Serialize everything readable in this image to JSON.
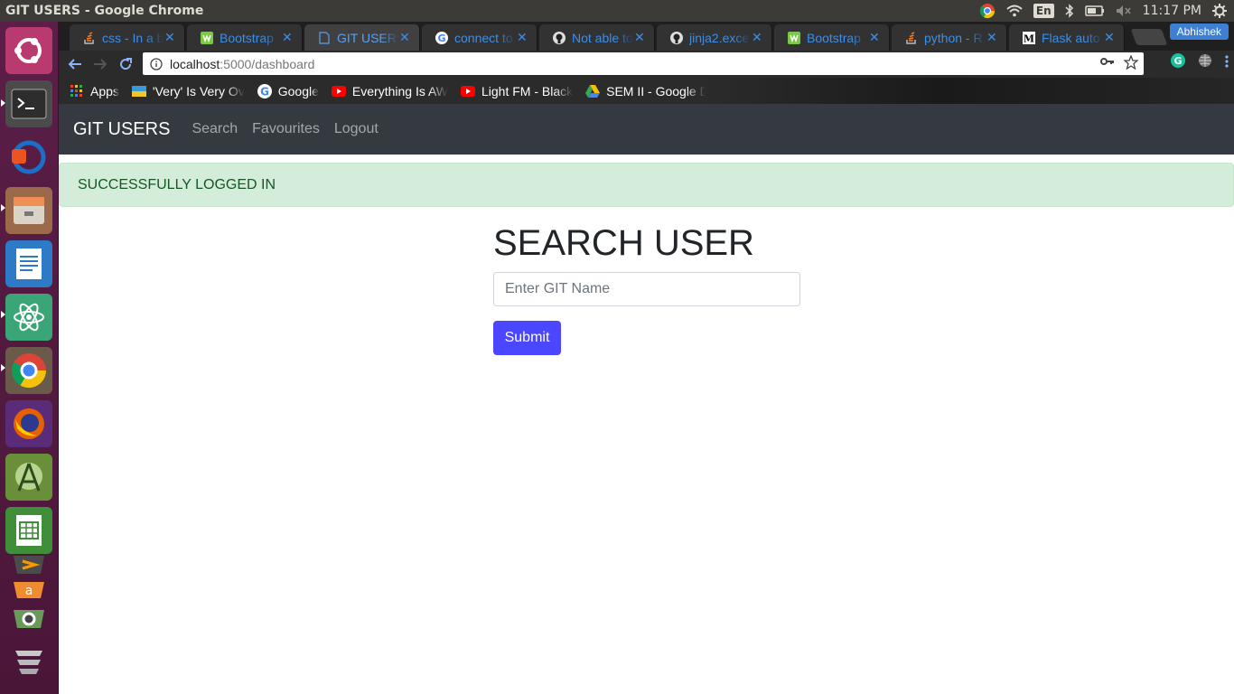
{
  "os_panel": {
    "window_title": "GIT USERS - Google Chrome",
    "language": "En",
    "clock": "11:17 PM"
  },
  "launcher": {
    "items": [
      "ubuntu-dash",
      "terminal",
      "software-updater",
      "files",
      "libreoffice-writer",
      "atom",
      "chrome",
      "firefox",
      "android-studio",
      "libreoffice-calc",
      "sublime-text",
      "amazon",
      "system-settings",
      "trash"
    ]
  },
  "browser": {
    "tabs": [
      {
        "label": "css - In a bu",
        "icon": "stackoverflow-icon"
      },
      {
        "label": "Bootstrap",
        "icon": "bootstrap-icon"
      },
      {
        "label": "GIT USERS",
        "icon": "page-icon",
        "active": true
      },
      {
        "label": "connect to",
        "icon": "google-icon"
      },
      {
        "label": "Not able to",
        "icon": "github-icon"
      },
      {
        "label": "jinja2.exce",
        "icon": "github-icon"
      },
      {
        "label": "Bootstrap",
        "icon": "bootstrap-icon"
      },
      {
        "label": "python - R",
        "icon": "stackoverflow-icon"
      },
      {
        "label": "Flask auto",
        "icon": "medium-icon"
      }
    ],
    "profile_name": "Abhishek",
    "url_host": "localhost",
    "url_rest": ":5000/dashboard",
    "bookmarks": [
      {
        "label": "Apps",
        "icon": "apps-grid-icon"
      },
      {
        "label": "'Very' Is Very Ov",
        "icon": "flag-icon"
      },
      {
        "label": "Google",
        "icon": "google-icon"
      },
      {
        "label": "Everything Is AW",
        "icon": "youtube-icon"
      },
      {
        "label": "Light FM - Black",
        "icon": "youtube-icon"
      },
      {
        "label": "SEM II - Google D",
        "icon": "drive-icon"
      }
    ]
  },
  "app": {
    "brand": "GIT USERS",
    "nav": {
      "search": "Search",
      "favourites": "Favourites",
      "logout": "Logout"
    },
    "alert": "SUCCESSFULLY LOGGED IN",
    "heading": "SEARCH USER",
    "input_placeholder": "Enter GIT Name",
    "submit_label": "Submit",
    "accent_color": "#4b46ff",
    "navbar_color": "#343a40"
  }
}
